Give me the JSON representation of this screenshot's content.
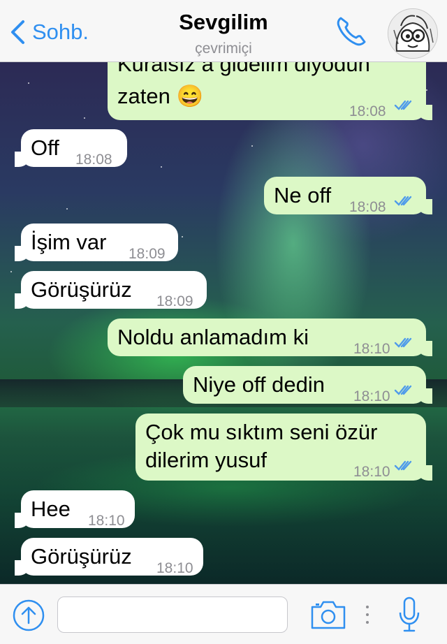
{
  "nav": {
    "back_label": "Sohb.",
    "contact_name": "Sevgilim",
    "status": "çevrimiçi"
  },
  "messages": [
    {
      "dir": "out",
      "text_line1": "Kuralsız a gidelim diyodun",
      "text_line2": "zaten 😄",
      "time": "18:08",
      "read": true
    },
    {
      "dir": "in",
      "text": "Off",
      "time": "18:08"
    },
    {
      "dir": "out",
      "text": "Ne off",
      "time": "18:08",
      "read": true
    },
    {
      "dir": "in",
      "text": "İşim var",
      "time": "18:09"
    },
    {
      "dir": "in",
      "text": "Görüşürüz",
      "time": "18:09"
    },
    {
      "dir": "out",
      "text": "Noldu anlamadım ki",
      "time": "18:10",
      "read": true
    },
    {
      "dir": "out",
      "text": "Niye off dedin",
      "time": "18:10",
      "read": true
    },
    {
      "dir": "out",
      "text_line1": "Çok mu sıktım seni özür",
      "text_line2": "dilerim yusuf",
      "time": "18:10",
      "read": true
    },
    {
      "dir": "in",
      "text": "Hee",
      "time": "18:10"
    },
    {
      "dir": "in",
      "text": "Görüşürüz",
      "time": "18:10"
    }
  ],
  "colors": {
    "accent": "#2f8ff0",
    "outgoing_bubble": "#dcf8c6",
    "incoming_bubble": "#ffffff",
    "read_ticks": "#4f9bea"
  },
  "icons": {
    "back": "chevron-left-icon",
    "call": "phone-icon",
    "upload": "upload-arrow-icon",
    "camera": "camera-icon",
    "mic": "microphone-icon"
  }
}
